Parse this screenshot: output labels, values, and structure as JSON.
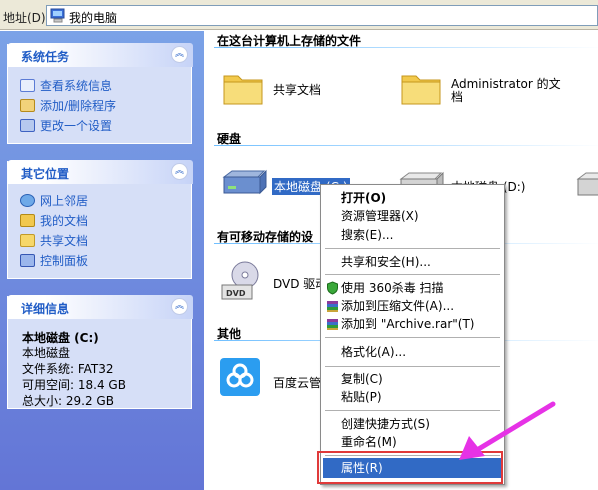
{
  "address": {
    "label": "地址(D)",
    "value": "我的电脑"
  },
  "left_panels": {
    "tasks": {
      "title": "系统任务",
      "items": [
        "查看系统信息",
        "添加/删除程序",
        "更改一个设置"
      ]
    },
    "places": {
      "title": "其它位置",
      "items": [
        "网上邻居",
        "我的文档",
        "共享文档",
        "控制面板"
      ]
    },
    "details": {
      "title": "详细信息",
      "name": "本地磁盘 (C:)",
      "type": "本地磁盘",
      "fs": "文件系统: FAT32",
      "free": "可用空间: 18.4 GB",
      "total": "总大小: 29.2 GB"
    }
  },
  "main": {
    "sections": [
      "在这台计算机上存储的文件",
      "硬盘",
      "有可移动存储的设",
      "其他"
    ],
    "files": [
      "共享文档",
      "Administrator 的文",
      "档"
    ],
    "drives": [
      "本地磁盘 (C:)",
      "本地磁盘 (D:)"
    ],
    "removable": "DVD 驱动",
    "other": "百度云管"
  },
  "context_menu": {
    "open": "打开(O)",
    "explorer": "资源管理器(X)",
    "search": "搜索(E)...",
    "share": "共享和安全(H)...",
    "scan": "使用 360杀毒 扫描",
    "compress": "添加到压缩文件(A)...",
    "archive": "添加到 \"Archive.rar\"(T)",
    "format": "格式化(A)...",
    "copy": "复制(C)",
    "paste": "粘贴(P)",
    "shortcut": "创建快捷方式(S)",
    "rename": "重命名(M)",
    "properties": "属性(R)"
  },
  "colors": {
    "accent": "#316ac5",
    "highlight_box": "#e03a3a",
    "arrow": "#e632e6",
    "panel_link": "#215dc6"
  }
}
